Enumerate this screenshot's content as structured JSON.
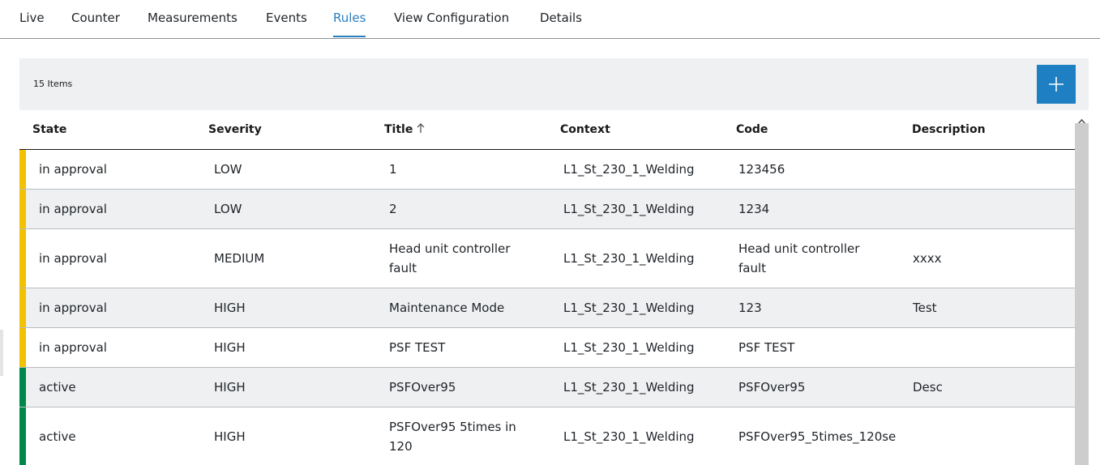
{
  "tabs": [
    {
      "label": "Live"
    },
    {
      "label": "Counter"
    },
    {
      "label": "Measurements"
    },
    {
      "label": "Events"
    },
    {
      "label": "Rules",
      "active": true
    },
    {
      "label": "View Configuration"
    },
    {
      "label": "Details"
    }
  ],
  "toolbar": {
    "item_count": "15 Items",
    "add_icon": "plus-icon"
  },
  "columns": [
    "State",
    "Severity",
    "Title",
    "Context",
    "Code",
    "Description"
  ],
  "sort": {
    "column": "Title",
    "direction": "ascending",
    "icon": "arrow-up-icon"
  },
  "colors": {
    "in_approval": "#f2c200",
    "active": "#00884a",
    "accent": "#1f7fc3"
  },
  "rows": [
    {
      "state": "in approval",
      "severity": "LOW",
      "title": "1",
      "title_2": "",
      "context": "L1_St_230_1_Welding",
      "code": "123456",
      "code_2": "",
      "description": "",
      "status": "in_approval"
    },
    {
      "state": "in approval",
      "severity": "LOW",
      "title": "2",
      "title_2": "",
      "context": "L1_St_230_1_Welding",
      "code": "1234",
      "code_2": "",
      "description": "",
      "status": "in_approval"
    },
    {
      "state": "in approval",
      "severity": "MEDIUM",
      "title": "Head unit controller",
      "title_2": "fault",
      "context": "L1_St_230_1_Welding",
      "code": "Head unit controller",
      "code_2": "fault",
      "description": "xxxx",
      "status": "in_approval"
    },
    {
      "state": "in approval",
      "severity": "HIGH",
      "title": "Maintenance Mode",
      "title_2": "",
      "context": "L1_St_230_1_Welding",
      "code": "123",
      "code_2": "",
      "description": "Test",
      "status": "in_approval"
    },
    {
      "state": "in approval",
      "severity": "HIGH",
      "title": "PSF TEST",
      "title_2": "",
      "context": "L1_St_230_1_Welding",
      "code": "PSF TEST",
      "code_2": "",
      "description": "",
      "status": "in_approval"
    },
    {
      "state": "active",
      "severity": "HIGH",
      "title": "PSFOver95",
      "title_2": "",
      "context": "L1_St_230_1_Welding",
      "code": "PSFOver95",
      "code_2": "",
      "description": "Desc",
      "status": "active"
    },
    {
      "state": "active",
      "severity": "HIGH",
      "title": "PSFOver95 5times in",
      "title_2": "120",
      "context": "L1_St_230_1_Welding",
      "code": "PSFOver95_5times_120se",
      "code_2": "",
      "description": "",
      "status": "active"
    }
  ]
}
